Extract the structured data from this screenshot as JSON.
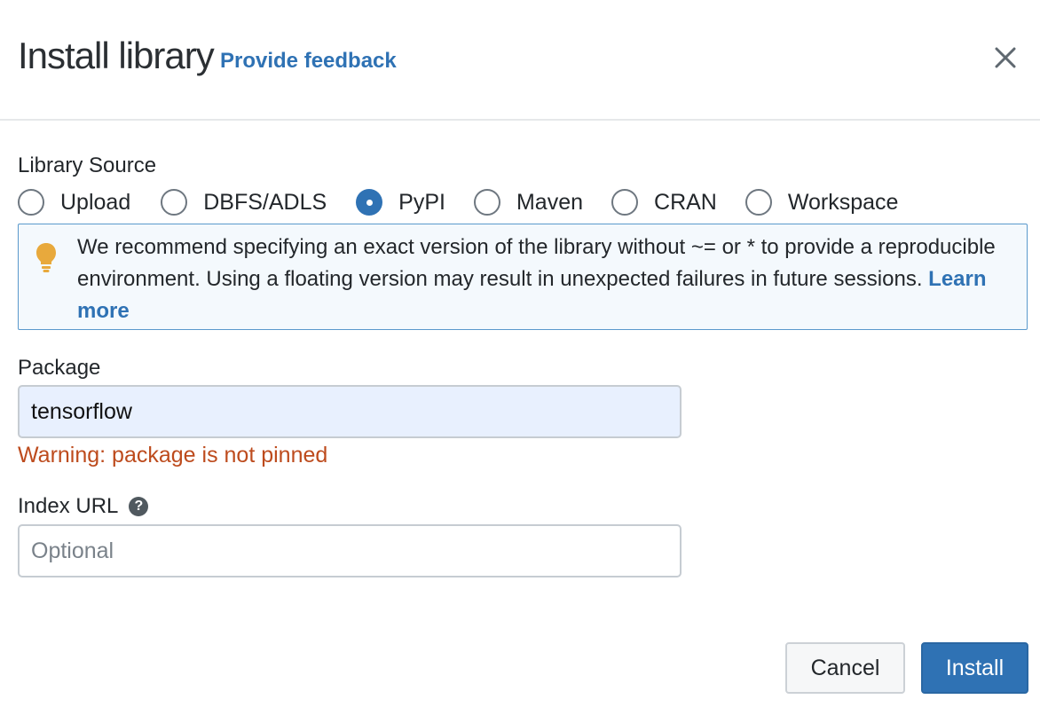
{
  "dialog": {
    "title": "Install library",
    "feedback_link": "Provide feedback",
    "close_icon": "close-icon"
  },
  "library_source": {
    "label": "Library Source",
    "selected": "PyPI",
    "options": [
      {
        "label": "Upload",
        "checked": false
      },
      {
        "label": "DBFS/ADLS",
        "checked": false
      },
      {
        "label": "PyPI",
        "checked": true
      },
      {
        "label": "Maven",
        "checked": false
      },
      {
        "label": "CRAN",
        "checked": false
      },
      {
        "label": "Workspace",
        "checked": false
      }
    ]
  },
  "alert": {
    "icon": "lightbulb-icon",
    "text": "We recommend specifying an exact version of the library without ~= or * to provide a reproducible environment. Using a floating version may result in unexpected failures in future sessions.",
    "link": "Learn more"
  },
  "package": {
    "label": "Package",
    "value": "tensorflow",
    "warning": "Warning: package is not pinned"
  },
  "index_url": {
    "label": "Index URL",
    "help_icon": "question-circle-icon",
    "help_glyph": "?",
    "value": "",
    "placeholder": "Optional"
  },
  "footer": {
    "cancel_label": "Cancel",
    "install_label": "Install"
  },
  "colors": {
    "accent": "#2f72b4",
    "warning": "#bd4b1d",
    "alert_border": "#5a99cc",
    "alert_bg": "#f4f9fd",
    "bulb": "#e8a93c",
    "input_autofill_bg": "#e8f0fe"
  }
}
